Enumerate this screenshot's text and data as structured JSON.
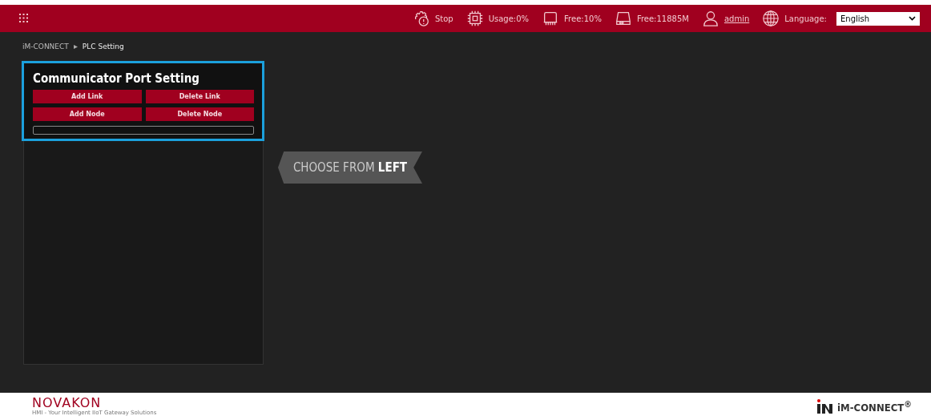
{
  "topbar": {
    "status": [
      {
        "kind": "stop",
        "label": "Stop"
      },
      {
        "kind": "cpu",
        "label": "Usage:0%"
      },
      {
        "kind": "memory",
        "label": "Free:10%"
      },
      {
        "kind": "disk",
        "label": "Free:11885M"
      }
    ],
    "user": "admin",
    "language_label": "Language:",
    "language": "English"
  },
  "breadcrumb": {
    "root": "iM-CONNECT",
    "current": "PLC Setting"
  },
  "panel": {
    "title": "Communicator Port Setting",
    "buttons": [
      "Add Link",
      "Delete Link",
      "Add Node",
      "Delete Node"
    ]
  },
  "hint": "CHOOSE FROM **LEFT**",
  "footer": {
    "brand": "NOVAKON",
    "tagline": "HMI - Your Intelligent IIoT Gateway Solutions",
    "product": "iM-CONNECT$^{®}$"
  }
}
